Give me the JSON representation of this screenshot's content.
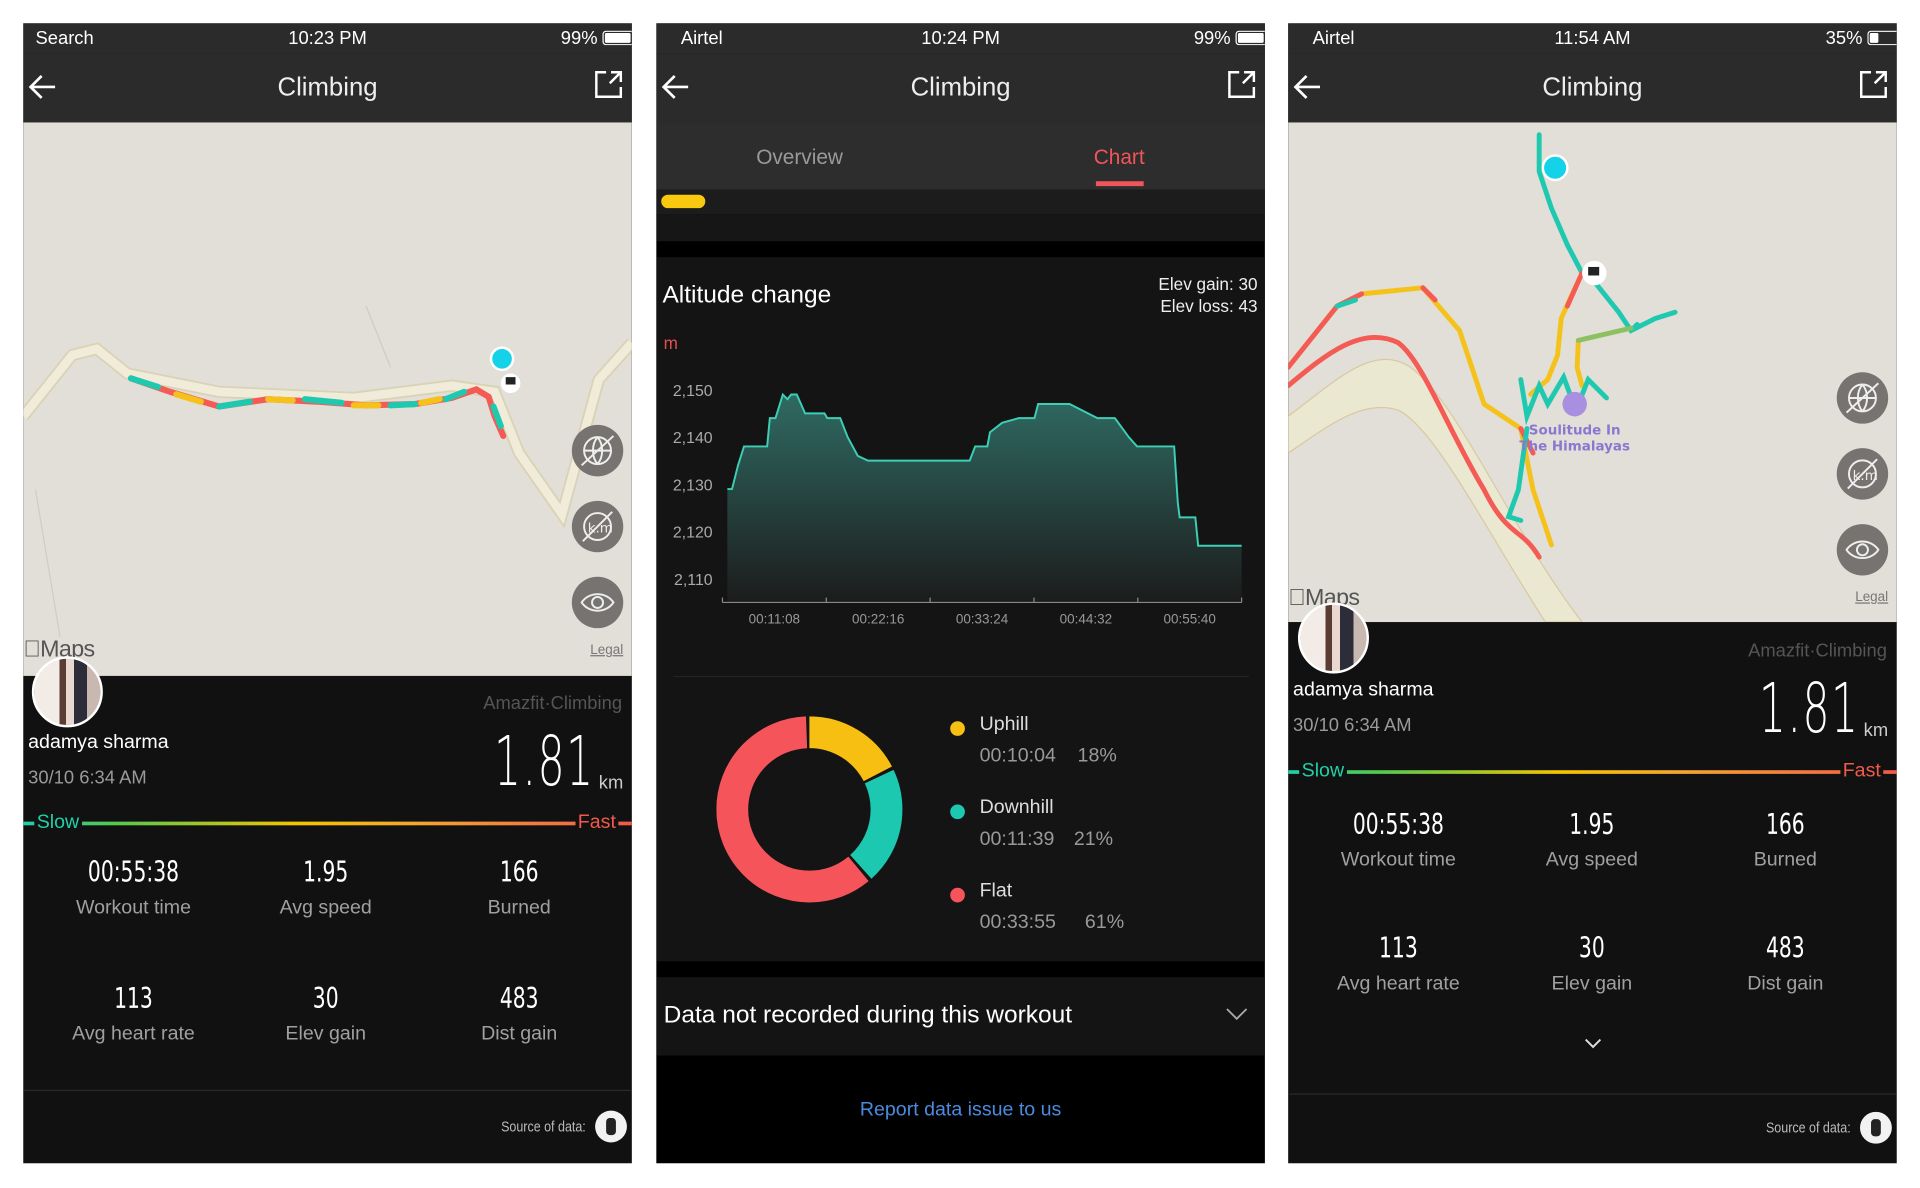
{
  "screens": [
    {
      "status": {
        "left": "Search",
        "time": "10:23 PM",
        "right": "99%",
        "battery_level": 0.99
      }
    },
    {
      "status": {
        "left": "Airtel",
        "time": "10:24 PM",
        "right": "99%",
        "battery_level": 0.99
      }
    },
    {
      "status": {
        "left": "Airtel",
        "time": "11:54 AM",
        "right": "35%",
        "battery_level": 0.35
      }
    }
  ],
  "nav": {
    "title": "Climbing",
    "back_icon": "arrow-left-icon",
    "share_icon": "share-icon"
  },
  "map": {
    "attribution": "Maps",
    "legal": "Legal",
    "poi_line1": "Soulitude In",
    "poi_line2": "The Himalayas",
    "route_colors": {
      "slow": "#1fc9b0",
      "medium": "#f5c21b",
      "fast": "#f45b55"
    }
  },
  "workout": {
    "user": "adamya sharma",
    "datetime": "30/10 6:34 AM",
    "source_app": "Amazfit·Climbing",
    "distance": "1.81",
    "distance_unit": "km",
    "slow_label": "Slow",
    "fast_label": "Fast",
    "stats": [
      {
        "value": "00:55:38",
        "label": "Workout time"
      },
      {
        "value": "1.95",
        "label": "Avg speed"
      },
      {
        "value": "166",
        "label": "Burned"
      },
      {
        "value": "113",
        "label": "Avg heart rate"
      },
      {
        "value": "30",
        "label": "Elev gain"
      },
      {
        "value": "483",
        "label": "Dist gain"
      }
    ],
    "source_label": "Source of data:"
  },
  "tabs": [
    {
      "label": "Overview",
      "active": false
    },
    {
      "label": "Chart",
      "active": true
    }
  ],
  "accent": "#f0555a",
  "altitude": {
    "title": "Altitude change",
    "elev_gain": "Elev gain: 30",
    "elev_loss": "Elev loss: 43",
    "unit": "m"
  },
  "chart_data": [
    {
      "type": "area",
      "title": "Altitude change",
      "ylabel": "m",
      "xlabel": "",
      "x_unit": "minutes",
      "x_tick_labels": [
        "00:11:08",
        "00:22:16",
        "00:33:24",
        "00:44:32",
        "00:55:40"
      ],
      "y_ticks": [
        2150,
        2140,
        2130,
        2120,
        2110
      ],
      "y_tick_labels": [
        "2,150",
        "2,140",
        "2,130",
        "2,120",
        "2,110"
      ],
      "xlim": [
        0,
        55.6
      ],
      "ylim": [
        2105,
        2155
      ],
      "grid": false,
      "color": "#3ccfb6",
      "x": [
        0,
        0.5,
        1.15,
        1.8,
        4.3,
        4.6,
        5.2,
        6.0,
        6.5,
        6.9,
        7.5,
        8.4,
        10.5,
        10.8,
        12.2,
        13.0,
        14.1,
        15.2,
        26.2,
        26.8,
        28.1,
        28.4,
        29.7,
        31.5,
        33.2,
        33.6,
        37.0,
        40.0,
        41.9,
        43.4,
        44.3,
        48.3,
        48.7,
        48.9,
        50.6,
        50.9,
        55.6
      ],
      "y": [
        2129,
        2129,
        2134,
        2138,
        2138,
        2144,
        2144,
        2149,
        2148,
        2149,
        2149,
        2145,
        2145,
        2144,
        2144,
        2140,
        2136,
        2135,
        2135,
        2138,
        2138,
        2141,
        2143,
        2144,
        2144,
        2147,
        2147,
        2144,
        2144,
        2140,
        2138,
        2138,
        2126,
        2123,
        2123,
        2117,
        2117
      ]
    },
    {
      "type": "pie",
      "donut": true,
      "legend": "right",
      "slices": [
        {
          "name": "Uphill",
          "time": "00:10:04",
          "percent": 18,
          "percent_label": "18%",
          "color": "#f8bf13"
        },
        {
          "name": "Downhill",
          "time": "00:11:39",
          "percent": 21,
          "percent_label": "21%",
          "color": "#1cc8b0"
        },
        {
          "name": "Flat",
          "time": "00:33:55",
          "percent": 61,
          "percent_label": "61%",
          "color": "#f5555a"
        }
      ]
    }
  ],
  "missing_data": {
    "label": "Data not recorded during this workout"
  },
  "report_link": "Report data issue to us"
}
